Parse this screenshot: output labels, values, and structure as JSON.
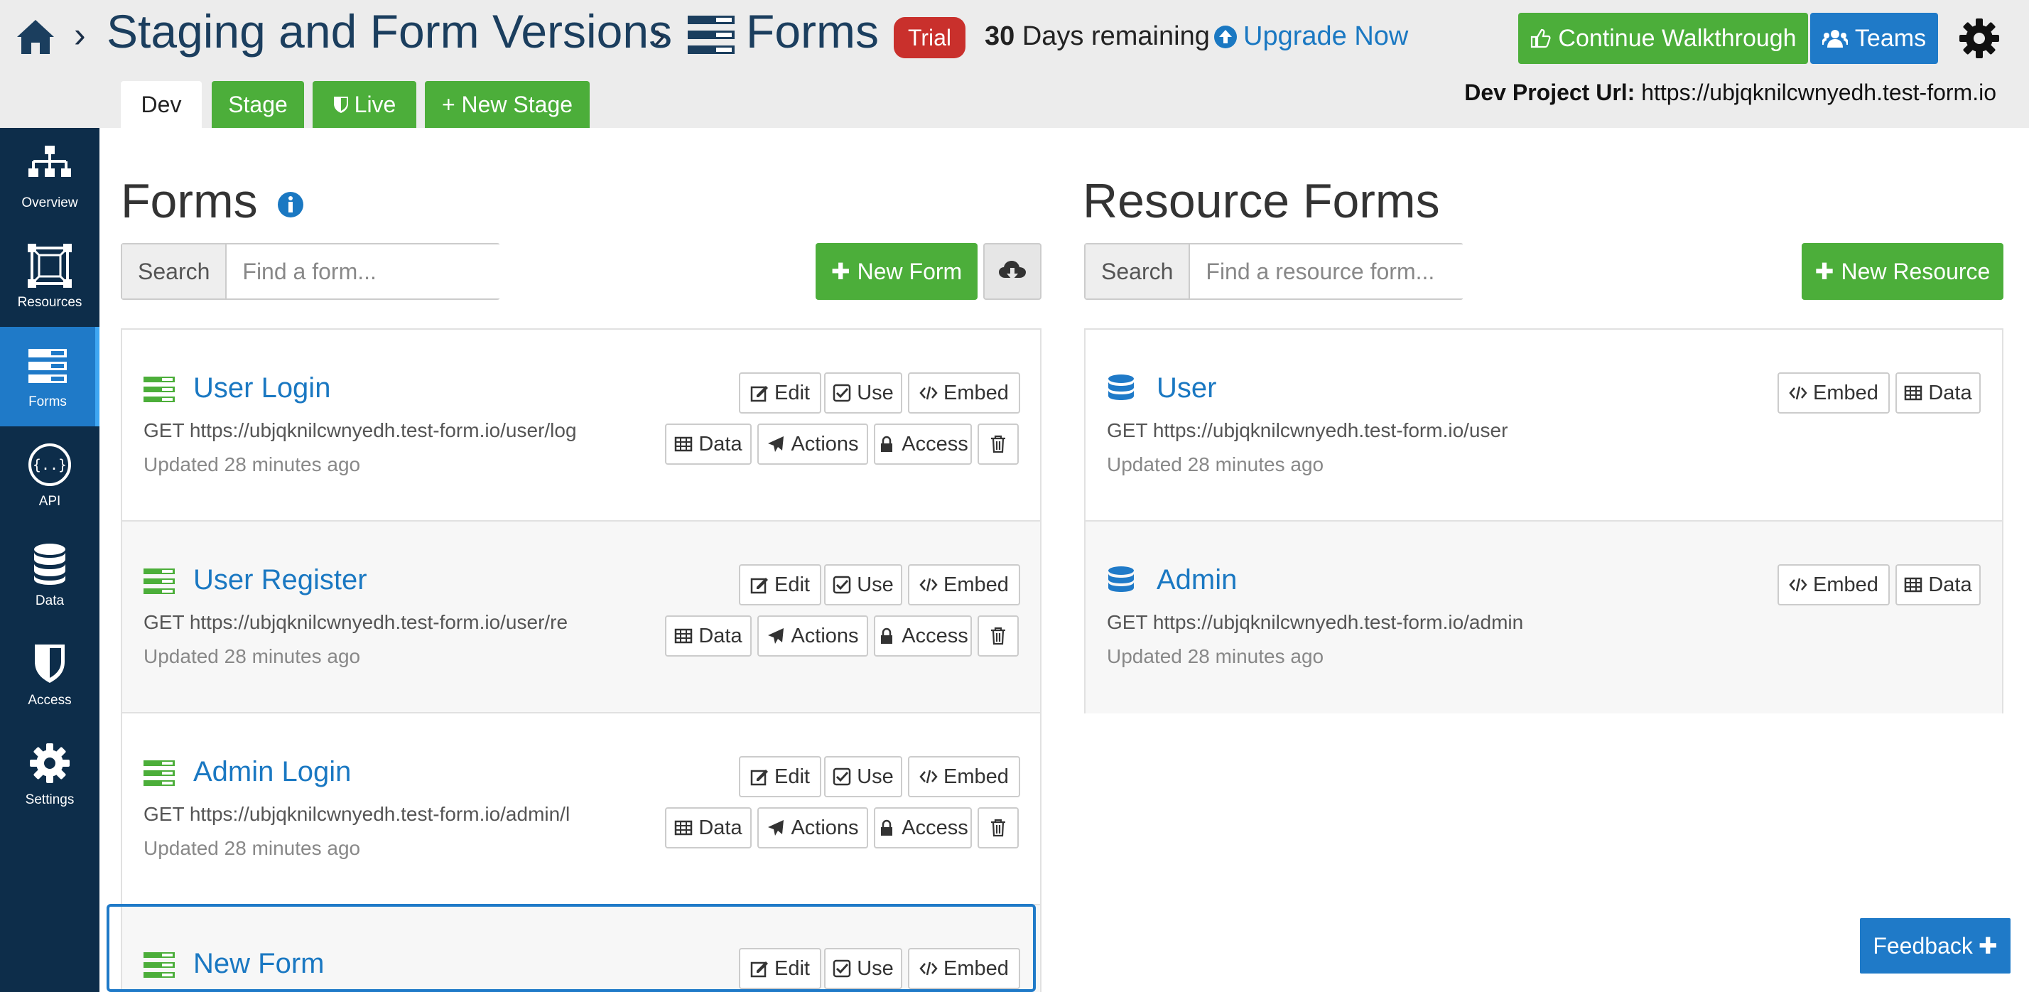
{
  "header": {
    "project_name": "Staging and Form Versions",
    "section_name": "Forms",
    "trial_badge": "Trial",
    "days_count": "30",
    "days_text": "Days remaining",
    "upgrade_label": "Upgrade Now",
    "walkthrough_label": "Continue Walkthrough",
    "teams_label": "Teams",
    "dev_url_label": "Dev Project Url:",
    "dev_url": "https://ubjqknilcwnyedh.test-form.io"
  },
  "stages": {
    "dev": "Dev",
    "stage": "Stage",
    "live": "Live",
    "new_stage": "+ New Stage"
  },
  "sidebar": {
    "items": [
      {
        "label": "Overview",
        "icon": "sitemap-icon"
      },
      {
        "label": "Resources",
        "icon": "resources-icon"
      },
      {
        "label": "Forms",
        "icon": "forms-icon"
      },
      {
        "label": "API",
        "icon": "api-icon"
      },
      {
        "label": "Data",
        "icon": "database-icon"
      },
      {
        "label": "Access",
        "icon": "shield-icon"
      },
      {
        "label": "Settings",
        "icon": "gear-icon"
      }
    ],
    "active": "Forms"
  },
  "forms_panel": {
    "title": "Forms",
    "search_addon": "Search",
    "search_placeholder": "Find a form...",
    "new_form_label": "New Form",
    "actions": {
      "edit": "Edit",
      "use": "Use",
      "embed": "Embed",
      "data": "Data",
      "actions": "Actions",
      "access": "Access"
    },
    "items": [
      {
        "title": "User Login",
        "url": "GET https://ubjqknilcwnyedh.test-form.io/user/log",
        "updated": "Updated 28 minutes ago"
      },
      {
        "title": "User Register",
        "url": "GET https://ubjqknilcwnyedh.test-form.io/user/re",
        "updated": "Updated 28 minutes ago"
      },
      {
        "title": "Admin Login",
        "url": "GET https://ubjqknilcwnyedh.test-form.io/admin/l",
        "updated": "Updated 28 minutes ago"
      },
      {
        "title": "New Form",
        "url": "",
        "updated": ""
      }
    ]
  },
  "resources_panel": {
    "title": "Resource Forms",
    "search_addon": "Search",
    "search_placeholder": "Find a resource form...",
    "new_resource_label": "New Resource",
    "actions": {
      "embed": "Embed",
      "data": "Data"
    },
    "items": [
      {
        "title": "User",
        "url": "GET https://ubjqknilcwnyedh.test-form.io/user",
        "updated": "Updated 28 minutes ago"
      },
      {
        "title": "Admin",
        "url": "GET https://ubjqknilcwnyedh.test-form.io/admin",
        "updated": "Updated 28 minutes ago"
      }
    ]
  },
  "feedback_label": "Feedback",
  "colors": {
    "navy": "#0d2d4a",
    "primary_blue": "#1f7ac8",
    "green": "#4cae3a",
    "trial_red": "#c9302c",
    "link_blue": "#1a78c2"
  }
}
